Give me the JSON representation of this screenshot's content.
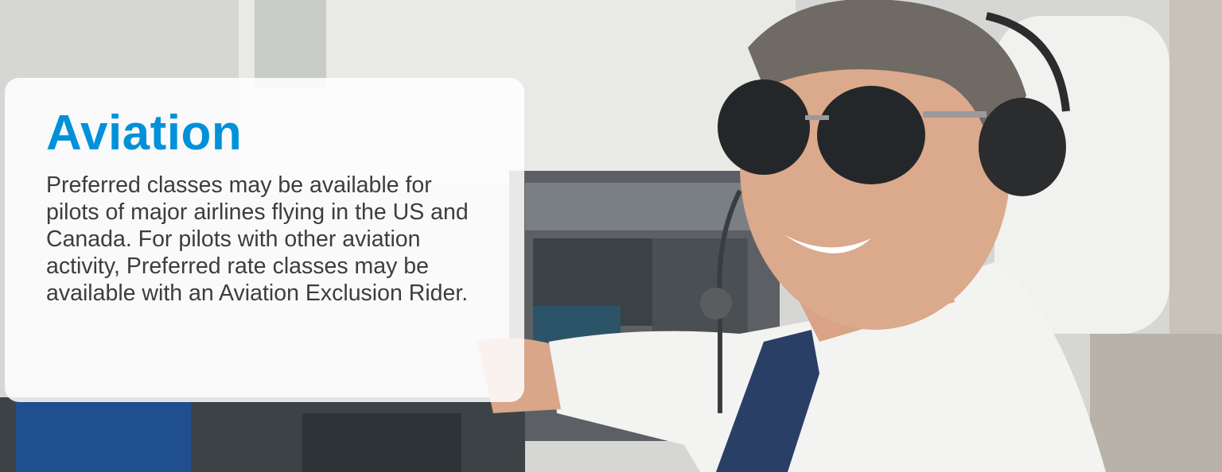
{
  "hero": {
    "title": "Aviation",
    "description": "Preferred classes may be available for pilots of major airlines flying in the US and Canada. For pilots with other aviation activity, Preferred rate classes may be available with an Aviation Exclusion Rider.",
    "image_subject": "pilot-in-cockpit-photo"
  },
  "colors": {
    "title": "#0091da",
    "body_text": "#3d3d3d",
    "card_background": "#ffffff"
  }
}
